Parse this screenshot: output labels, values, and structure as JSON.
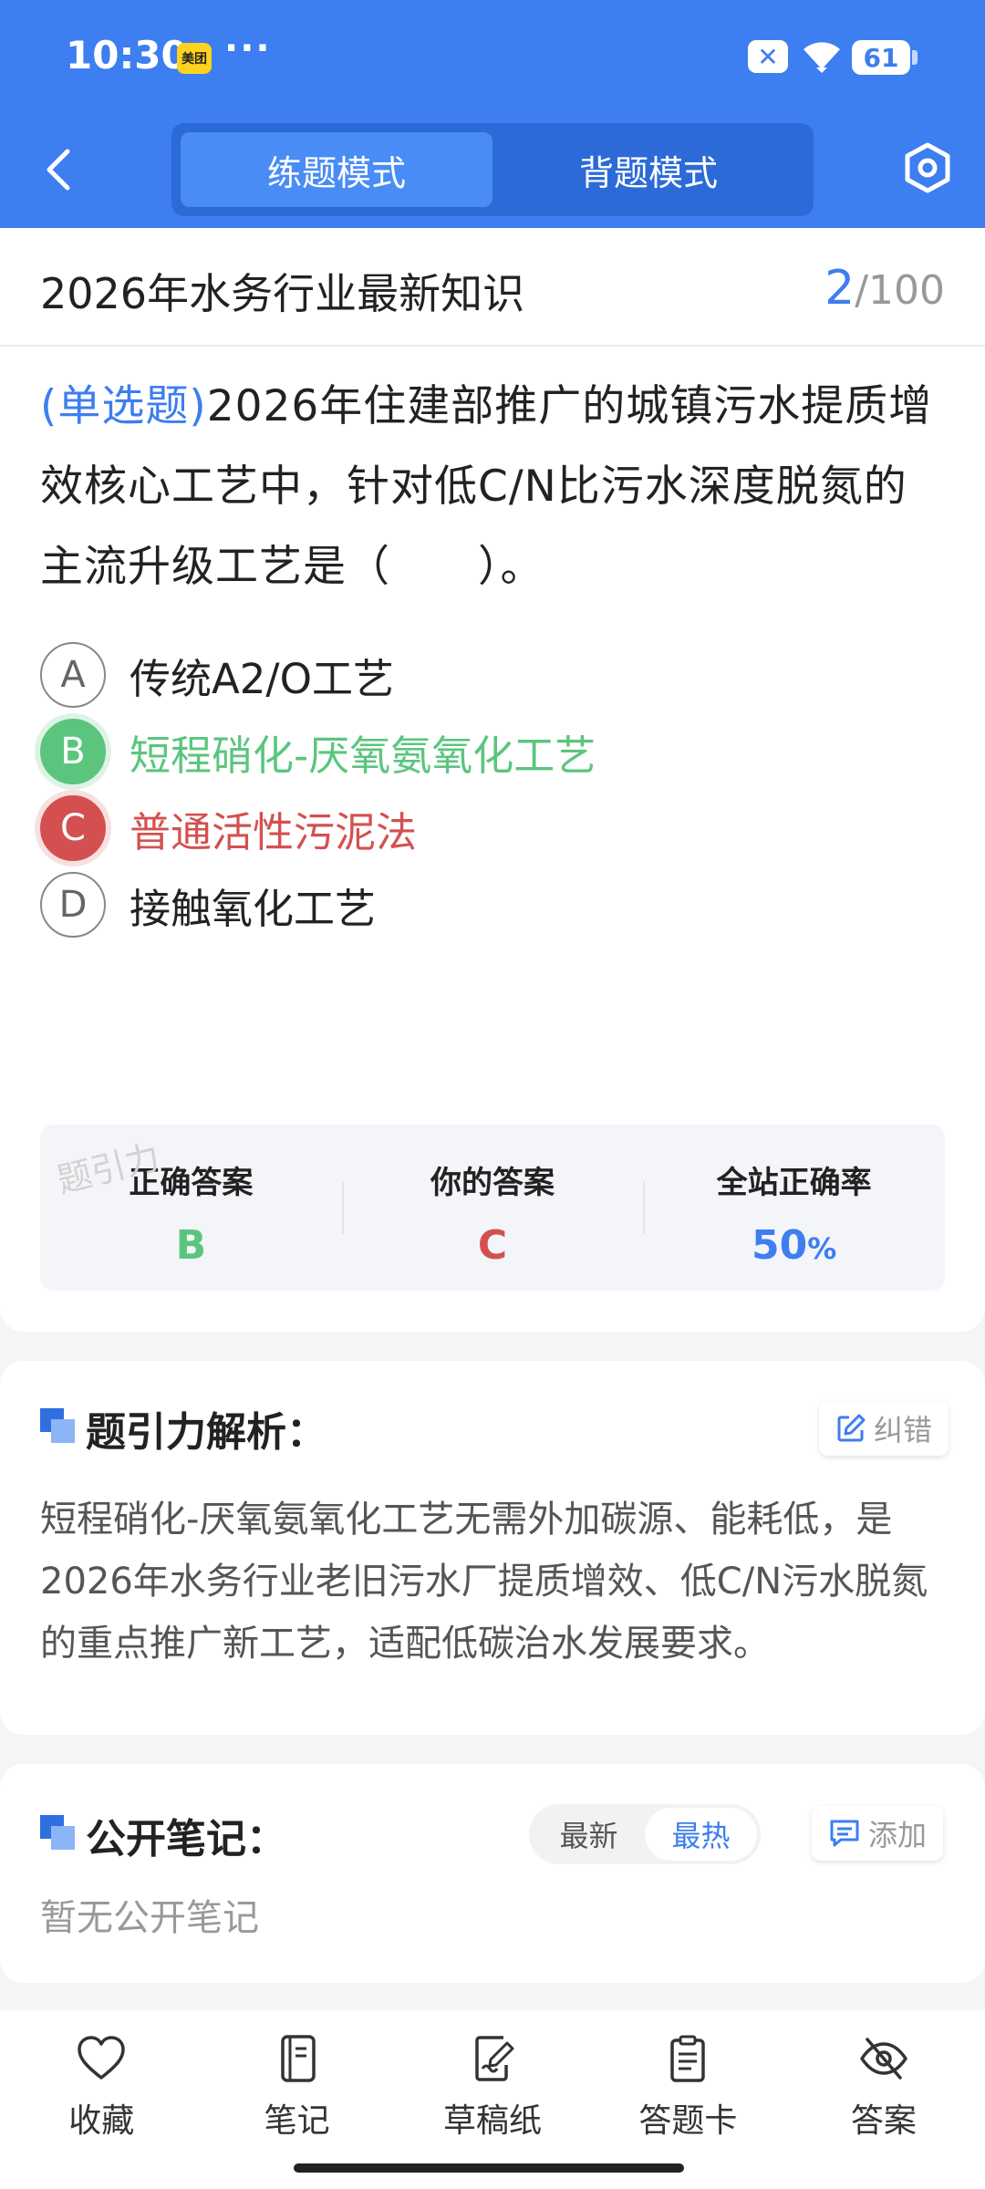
{
  "status_bar": {
    "time": "10:30",
    "app_badge": "美团",
    "more": "···",
    "battery": "61"
  },
  "header": {
    "tabs": [
      {
        "label": "练题模式",
        "active": true
      },
      {
        "label": "背题模式",
        "active": false
      }
    ]
  },
  "question_bank": {
    "title": "2026年水务行业最新知识",
    "current": "2",
    "total": "/100"
  },
  "question": {
    "type": "(单选题)",
    "text": "2026年住建部推广的城镇污水提质增效核心工艺中，针对低C/N比污水深度脱氮的主流升级工艺是（　　）。",
    "options": [
      {
        "letter": "A",
        "text": "传统A2/O工艺",
        "state": "normal"
      },
      {
        "letter": "B",
        "text": "短程硝化-厌氧氨氧化工艺",
        "state": "correct"
      },
      {
        "letter": "C",
        "text": "普通活性污泥法",
        "state": "wrong"
      },
      {
        "letter": "D",
        "text": "接触氧化工艺",
        "state": "normal"
      }
    ]
  },
  "result": {
    "correct_label": "正确答案",
    "correct_value": "B",
    "yours_label": "你的答案",
    "yours_value": "C",
    "rate_label": "全站正确率",
    "rate_value": "50",
    "rate_unit": "%",
    "watermark": "题引力"
  },
  "analysis": {
    "title": "题引力解析：",
    "report_label": "纠错",
    "text": "短程硝化-厌氧氨氧化工艺无需外加碳源、能耗低，是2026年水务行业老旧污水厂提质增效、低C/N污水脱氮的重点推广新工艺，适配低碳治水发展要求。"
  },
  "notes": {
    "title": "公开笔记：",
    "sort_latest": "最新",
    "sort_hot": "最热",
    "add_label": "添加",
    "empty": "暂无公开笔记"
  },
  "toolbar": {
    "items": [
      {
        "label": "收藏",
        "icon": "heart-icon"
      },
      {
        "label": "笔记",
        "icon": "notebook-icon"
      },
      {
        "label": "草稿纸",
        "icon": "draft-icon"
      },
      {
        "label": "答题卡",
        "icon": "answer-card-icon"
      },
      {
        "label": "答案",
        "icon": "eye-off-icon"
      }
    ]
  },
  "colors": {
    "primary": "#3d7ef0",
    "correct": "#5bc57e",
    "wrong": "#d45050"
  }
}
